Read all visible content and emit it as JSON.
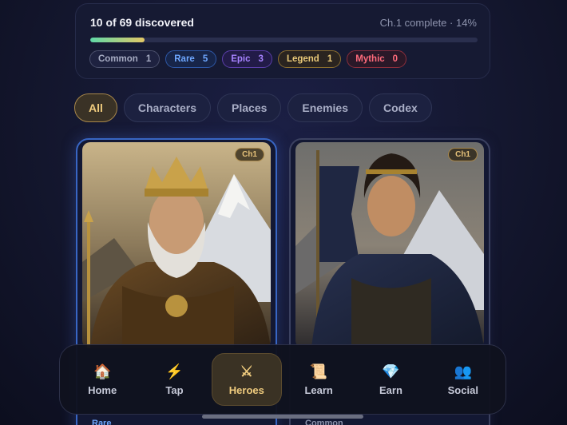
{
  "progress": {
    "title": "10 of 69 discovered",
    "status": "Ch.1 complete · 14%",
    "percent": 14,
    "chips": [
      {
        "name": "Common",
        "count": "1",
        "color": "#a7acc3"
      },
      {
        "name": "Rare",
        "count": "5",
        "color": "#6ea7ff"
      },
      {
        "name": "Epic",
        "count": "3",
        "color": "#a783ff"
      },
      {
        "name": "Legend",
        "count": "1",
        "color": "#e9c978"
      },
      {
        "name": "Mythic",
        "count": "0",
        "color": "#ff6b7c"
      }
    ]
  },
  "tabs": [
    {
      "label": "All",
      "active": true
    },
    {
      "label": "Characters",
      "active": false
    },
    {
      "label": "Places",
      "active": false
    },
    {
      "label": "Enemies",
      "active": false
    },
    {
      "label": "Codex",
      "active": false
    }
  ],
  "cards": [
    {
      "chapter": "Ch1",
      "rarity": "Rare",
      "art": "crowned-king-portrait"
    },
    {
      "chapter": "Ch1",
      "rarity": "Common",
      "art": "cloaked-warrior-portrait"
    }
  ],
  "nav": [
    {
      "label": "Home",
      "icon": "🏠",
      "icon_name": "home-icon",
      "active": false
    },
    {
      "label": "Tap",
      "icon": "⚡",
      "icon_name": "lightning-icon",
      "active": false
    },
    {
      "label": "Heroes",
      "icon": "⚔",
      "icon_name": "crossed-swords-icon",
      "active": true
    },
    {
      "label": "Learn",
      "icon": "📜",
      "icon_name": "scroll-icon",
      "active": false
    },
    {
      "label": "Earn",
      "icon": "💎",
      "icon_name": "gem-icon",
      "active": false
    },
    {
      "label": "Social",
      "icon": "👥",
      "icon_name": "people-icon",
      "active": false
    }
  ],
  "colors": {
    "accent": "#f0cc7e",
    "rare_border": "#3866c4"
  }
}
